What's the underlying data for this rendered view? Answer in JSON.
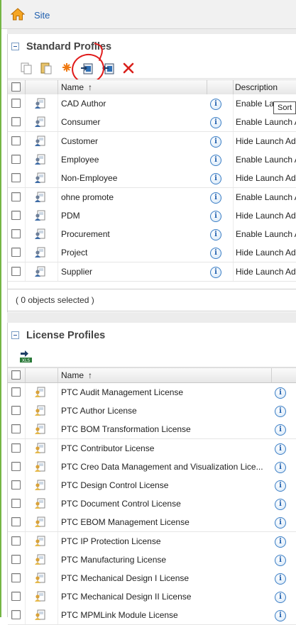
{
  "breadcrumb": {
    "site_label": "Site"
  },
  "standard_profiles": {
    "title": "Standard Profiles",
    "columns": {
      "name": "Name",
      "sort_indicator": "↑",
      "description": "Description"
    },
    "rows": [
      {
        "name": "CAD Author",
        "description": "Enable La"
      },
      {
        "name": "Consumer",
        "description": "Enable Launch A"
      },
      {
        "name": "Customer",
        "description": "Hide Launch Ad"
      },
      {
        "name": "Employee",
        "description": "Enable Launch A"
      },
      {
        "name": "Non-Employee",
        "description": "Hide Launch Ad"
      },
      {
        "name": "ohne promote",
        "description": "Enable Launch A"
      },
      {
        "name": "PDM",
        "description": "Hide Launch Ad"
      },
      {
        "name": "Procurement",
        "description": "Enable Launch A"
      },
      {
        "name": "Project",
        "description": "Hide Launch Ad"
      },
      {
        "name": "Supplier",
        "description": "Hide Launch Ad"
      }
    ],
    "selection_status": "( 0 objects selected )",
    "tooltip": "Sort"
  },
  "license_profiles": {
    "title": "License Profiles",
    "columns": {
      "name": "Name",
      "sort_indicator": "↑"
    },
    "rows": [
      {
        "name": "PTC Audit Management License"
      },
      {
        "name": "PTC Author License"
      },
      {
        "name": "PTC BOM Transformation License"
      },
      {
        "name": "PTC Contributor License"
      },
      {
        "name": "PTC Creo Data Management and Visualization Lice..."
      },
      {
        "name": "PTC Design Control License"
      },
      {
        "name": "PTC Document Control License"
      },
      {
        "name": "PTC EBOM Management License"
      },
      {
        "name": "PTC IP Protection License"
      },
      {
        "name": "PTC Manufacturing License"
      },
      {
        "name": "PTC Mechanical Design I License"
      },
      {
        "name": "PTC Mechanical Design II License"
      },
      {
        "name": "PTC MPMLink Module License"
      }
    ]
  },
  "icons": {
    "info_glyph": "i",
    "home": "home-icon",
    "copy": "copy-icon",
    "paste": "paste-icon",
    "new": "new-profile-icon",
    "export": "export-icon",
    "import": "import-icon",
    "delete": "delete-icon",
    "xls": "export-xls-icon"
  },
  "colors": {
    "accent_green": "#74b544",
    "link_blue": "#1f5fae",
    "delete_red": "#e01a1a"
  }
}
